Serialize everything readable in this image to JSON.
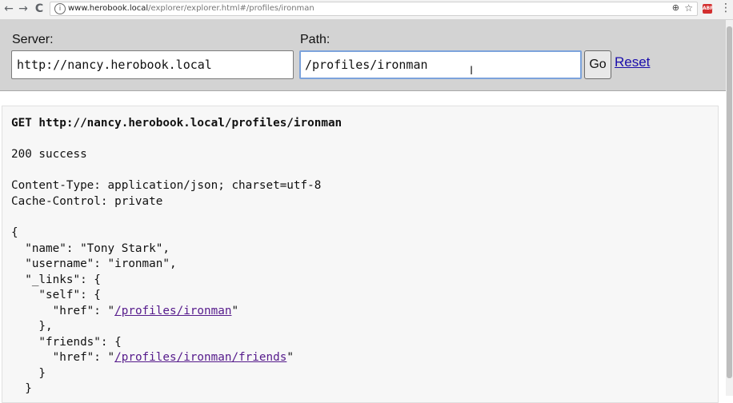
{
  "browser": {
    "back_icon": "←",
    "forward_icon": "→",
    "reload_icon": "C",
    "info_icon": "i",
    "url_host": "www.herobook.local",
    "url_path": "/explorer/explorer.html#/profiles/ironman",
    "zoom_icon": "⊕",
    "star_icon": "☆",
    "extension_label": "ABP",
    "menu_icon": "⋮"
  },
  "toolbar": {
    "server_label": "Server:",
    "server_value": "http://nancy.herobook.local",
    "path_label": "Path:",
    "path_value": "/profiles/ironman",
    "go_label": "Go",
    "reset_label": "Reset"
  },
  "response": {
    "request_line": "GET http://nancy.herobook.local/profiles/ironman",
    "status": "200 success",
    "headers": [
      "Content-Type: application/json; charset=utf-8",
      "Cache-Control: private"
    ],
    "body": {
      "open_brace": "{",
      "name_line": "  \"name\": \"Tony Stark\",",
      "username_line": "  \"username\": \"ironman\",",
      "links_line": "  \"_links\": {",
      "self_line": "    \"self\": {",
      "self_href_prefix": "      \"href\": \"",
      "self_href": "/profiles/ironman",
      "href_suffix": "\"",
      "self_close": "    },",
      "friends_line": "    \"friends\": {",
      "friends_href_prefix": "      \"href\": \"",
      "friends_href": "/profiles/ironman/friends",
      "friends_close": "    }",
      "links_close": "  }"
    }
  },
  "colors": {
    "toolbar_bg": "#d3d3d3",
    "link": "#1a0dab",
    "visited_link": "#551a8b",
    "focus_border": "#7ca3dc"
  }
}
